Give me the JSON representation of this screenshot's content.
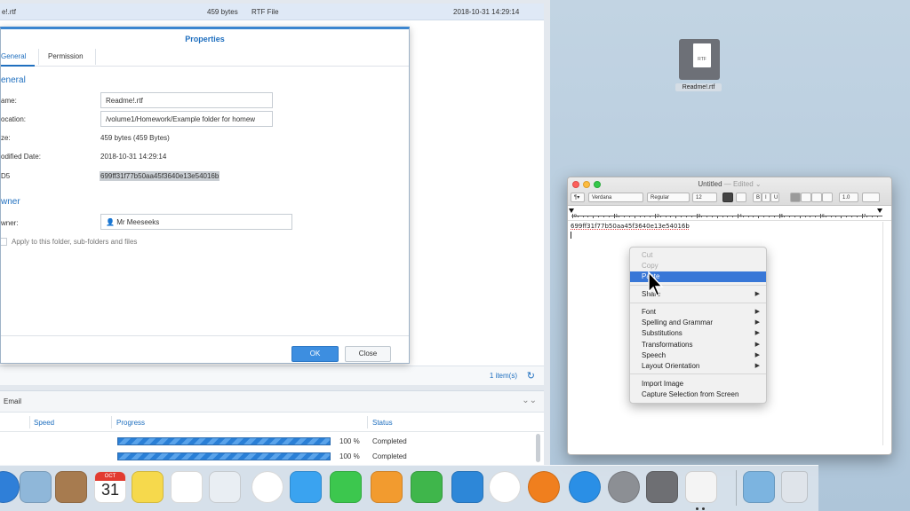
{
  "file_list": {
    "row": {
      "name": "e!.rtf",
      "size": "459 bytes",
      "type": "RTF File",
      "modified": "2018-10-31 14:29:14"
    }
  },
  "properties": {
    "title": "Properties",
    "tabs": [
      {
        "label": "General"
      },
      {
        "label": "Permission"
      }
    ],
    "general_section": "eneral",
    "fields": {
      "name_label": "ame:",
      "name_value": "Readme!.rtf",
      "location_label": "ocation:",
      "location_value": "/volume1/Homework/Example folder for homew",
      "size_label": "ze:",
      "size_value": "459 bytes (459 Bytes)",
      "modified_label": "odified Date:",
      "modified_value": "2018-10-31 14:29:14",
      "md5_label": "D5",
      "md5_value": "699ff31f77b50aa45f3640e13e54016b"
    },
    "owner_section": "wner",
    "owner_label": "wner:",
    "owner_value": "Mr Meeseeks",
    "apply_label": "Apply to this folder, sub-folders and files",
    "ok_label": "OK",
    "close_label": "Close"
  },
  "footer": {
    "items": "1 item(s)"
  },
  "transfer": {
    "tab": "Email",
    "columns": {
      "speed": "Speed",
      "progress": "Progress",
      "status": "Status"
    },
    "rows": [
      {
        "progress": 1.0,
        "percent": "100 %",
        "status": "Completed"
      },
      {
        "progress": 1.0,
        "percent": "100 %",
        "status": "Completed"
      }
    ]
  },
  "desktop_file": {
    "icon_text": "RTF",
    "name": "Readme!.rtf"
  },
  "textedit": {
    "title": "Untitled",
    "edited": "— Edited ⌄",
    "toolbar": {
      "paragraph": "¶▾",
      "font": "Verdana",
      "style": "Regular",
      "size": "12",
      "bold": "B",
      "italic": "I",
      "underline": "U",
      "spacing": "1.0"
    },
    "ruler_numbers": [
      "0",
      "1",
      "2",
      "3",
      "4",
      "5",
      "6",
      "7"
    ],
    "content": "699ff31f77b50aa45f3640e13e54016b"
  },
  "context_menu": {
    "items": [
      {
        "label": "Cut",
        "disabled": true
      },
      {
        "label": "Copy",
        "disabled": true
      },
      {
        "label": "Paste",
        "highlighted": true
      },
      {
        "label": "Share",
        "submenu": true
      },
      {
        "label": "Font",
        "submenu": true
      },
      {
        "label": "Spelling and Grammar",
        "submenu": true
      },
      {
        "label": "Substitutions",
        "submenu": true
      },
      {
        "label": "Transformations",
        "submenu": true
      },
      {
        "label": "Speech",
        "submenu": true
      },
      {
        "label": "Layout Orientation",
        "submenu": true
      },
      {
        "label": "Import Image"
      },
      {
        "label": "Capture Selection from Screen"
      }
    ],
    "submenu_arrow": "▶"
  },
  "dock": {
    "calendar_month": "OCT",
    "calendar_day": "31",
    "apps": [
      "safari-icon",
      "preview-icon",
      "contacts-icon",
      "calendar-icon",
      "notes-icon",
      "reminders-icon",
      "photo-booth-icon",
      "photos-icon",
      "messages-icon",
      "facetime-icon",
      "pages-icon",
      "numbers-icon",
      "keynote-icon",
      "itunes-icon",
      "ibooks-icon",
      "app-store-icon",
      "system-preferences-icon",
      "final-cut-icon",
      "textedit-icon",
      "downloads-icon",
      "trash-icon"
    ]
  }
}
